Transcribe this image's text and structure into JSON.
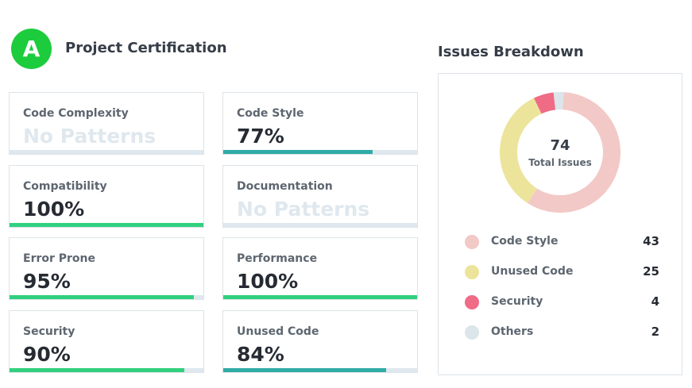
{
  "project": {
    "grade": "A",
    "title": "Project Certification"
  },
  "metrics": [
    {
      "label": "Code Complexity",
      "value": "No Patterns",
      "fill": null,
      "color": "green"
    },
    {
      "label": "Code Style",
      "value": "77%",
      "fill": 77,
      "color": "teal"
    },
    {
      "label": "Compatibility",
      "value": "100%",
      "fill": 100,
      "color": "green"
    },
    {
      "label": "Documentation",
      "value": "No Patterns",
      "fill": null,
      "color": "green"
    },
    {
      "label": "Error Prone",
      "value": "95%",
      "fill": 95,
      "color": "green"
    },
    {
      "label": "Performance",
      "value": "100%",
      "fill": 100,
      "color": "green"
    },
    {
      "label": "Security",
      "value": "90%",
      "fill": 90,
      "color": "green"
    },
    {
      "label": "Unused Code",
      "value": "84%",
      "fill": 84,
      "color": "teal"
    }
  ],
  "issues": {
    "title": "Issues Breakdown",
    "total": "74",
    "total_label": "Total Issues",
    "legend": [
      {
        "name": "Code Style",
        "count": "43",
        "color": "#f2c9c6"
      },
      {
        "name": "Unused Code",
        "count": "25",
        "color": "#ece49b"
      },
      {
        "name": "Security",
        "count": "4",
        "color": "#ef6b86"
      },
      {
        "name": "Others",
        "count": "2",
        "color": "#dbe5ea"
      }
    ]
  },
  "chart_data": {
    "type": "pie",
    "categories": [
      "Code Style",
      "Unused Code",
      "Security",
      "Others"
    ],
    "values": [
      43,
      25,
      4,
      2
    ]
  },
  "colors": {
    "grade": "#1dcc3d",
    "green_bar": "#31d07f",
    "teal_bar": "#30aba5",
    "track": "#dfe8ee"
  }
}
